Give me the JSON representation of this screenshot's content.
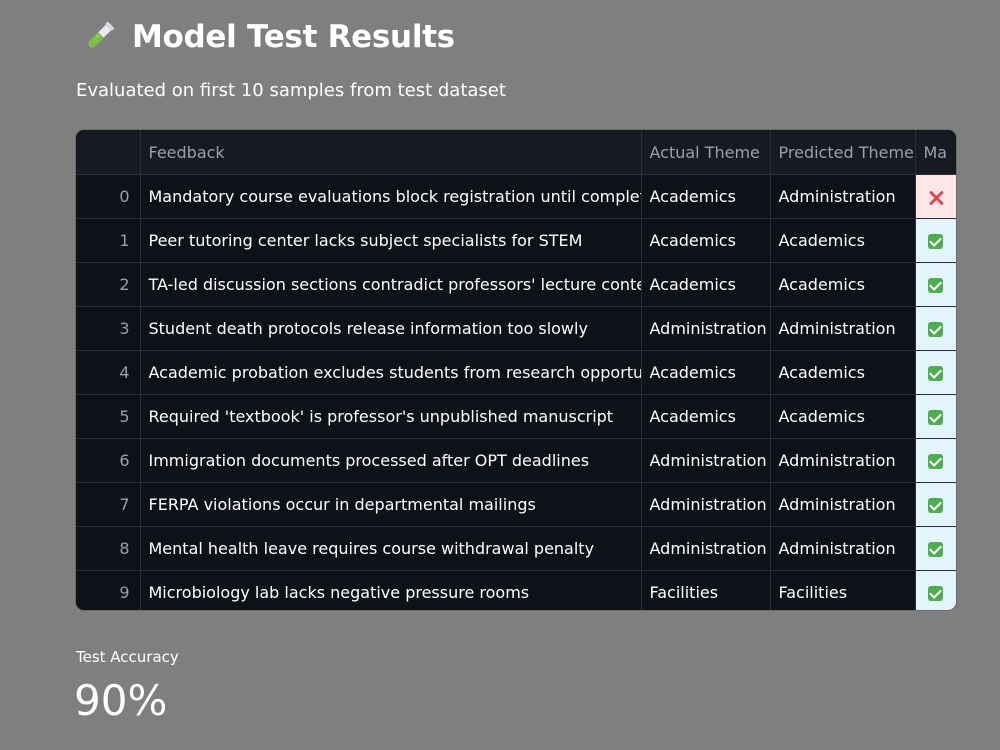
{
  "header": {
    "icon": "test-tube-icon",
    "title": "Model Test Results",
    "subtitle": "Evaluated on first 10 samples from test dataset"
  },
  "table": {
    "columns": [
      "",
      "Feedback",
      "Actual Theme",
      "Predicted Theme",
      "Ma"
    ],
    "rows": [
      {
        "index": "0",
        "feedback": "Mandatory course evaluations block registration until completed",
        "actual": "Academics",
        "predicted": "Administration",
        "match": "cross-icon"
      },
      {
        "index": "1",
        "feedback": "Peer tutoring center lacks subject specialists for STEM",
        "actual": "Academics",
        "predicted": "Academics",
        "match": "check-icon"
      },
      {
        "index": "2",
        "feedback": "TA-led discussion sections contradict professors' lecture content",
        "actual": "Academics",
        "predicted": "Academics",
        "match": "check-icon"
      },
      {
        "index": "3",
        "feedback": "Student death protocols release information too slowly",
        "actual": "Administration",
        "predicted": "Administration",
        "match": "check-icon"
      },
      {
        "index": "4",
        "feedback": "Academic probation excludes students from research opportunities",
        "actual": "Academics",
        "predicted": "Academics",
        "match": "check-icon"
      },
      {
        "index": "5",
        "feedback": "Required 'textbook' is professor's unpublished manuscript",
        "actual": "Academics",
        "predicted": "Academics",
        "match": "check-icon"
      },
      {
        "index": "6",
        "feedback": "Immigration documents processed after OPT deadlines",
        "actual": "Administration",
        "predicted": "Administration",
        "match": "check-icon"
      },
      {
        "index": "7",
        "feedback": "FERPA violations occur in departmental mailings",
        "actual": "Administration",
        "predicted": "Administration",
        "match": "check-icon"
      },
      {
        "index": "8",
        "feedback": "Mental health leave requires course withdrawal penalty",
        "actual": "Administration",
        "predicted": "Administration",
        "match": "check-icon"
      },
      {
        "index": "9",
        "feedback": "Microbiology lab lacks negative pressure rooms",
        "actual": "Facilities",
        "predicted": "Facilities",
        "match": "check-icon"
      }
    ]
  },
  "metric": {
    "label": "Test Accuracy",
    "value": "90%"
  },
  "colors": {
    "background": "#7f7f7f",
    "table_bg": "#0e1117",
    "match_ok_bg": "#e3f4fc",
    "match_bad_bg": "#fde6e6",
    "check_green": "#4cae4f",
    "cross_red": "#e0475a"
  }
}
